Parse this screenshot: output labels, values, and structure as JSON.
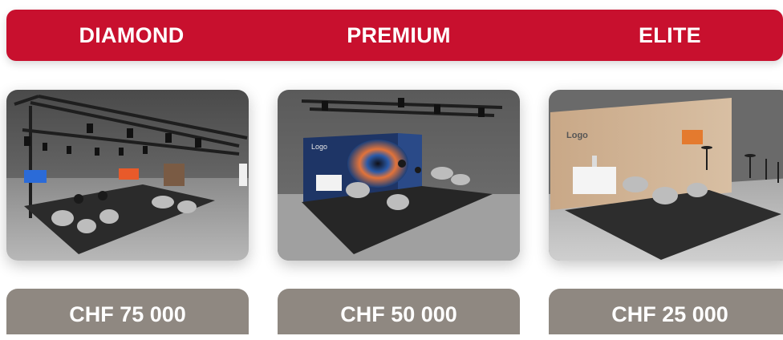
{
  "header": {
    "tiers": [
      "DIAMOND",
      "PREMIUM",
      "ELITE"
    ]
  },
  "cards": [
    {
      "name": "DIAMOND",
      "price": "CHF 75 000"
    },
    {
      "name": "PREMIUM",
      "price": "CHF 50 000",
      "backdrop_text": "Logo"
    },
    {
      "name": "ELITE",
      "price": "CHF 25 000",
      "backdrop_text": "Logo"
    }
  ],
  "colors": {
    "accent_red": "#c8102e",
    "price_bg": "#8f8881",
    "text": "#ffffff"
  }
}
